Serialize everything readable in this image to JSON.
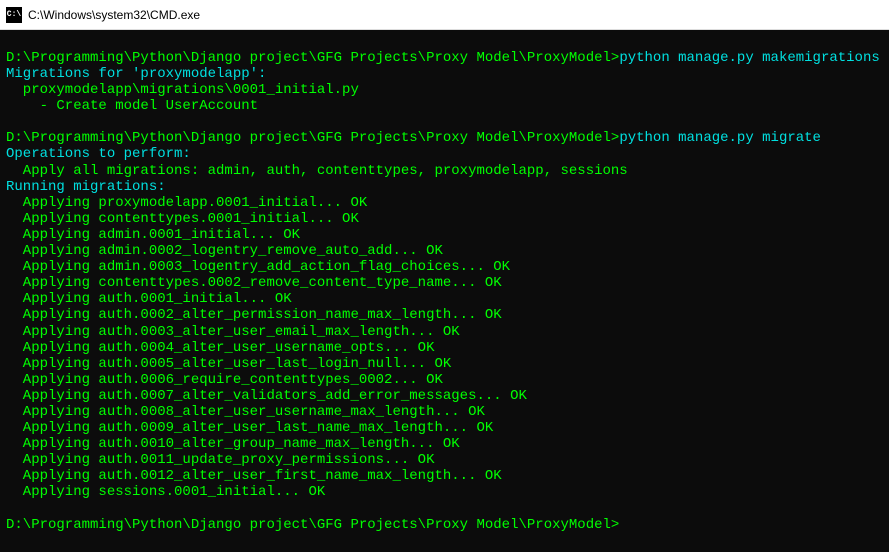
{
  "window": {
    "title": "C:\\Windows\\system32\\CMD.exe",
    "icon_label": "C:\\"
  },
  "terminal": {
    "prompt_path": "D:\\Programming\\Python\\Django project\\GFG Projects\\Proxy Model\\ProxyModel>",
    "commands": {
      "makemigrations": "python manage.py makemigrations",
      "migrate": "python manage.py migrate"
    },
    "makemigrations_output": {
      "header": "Migrations for 'proxymodelapp':",
      "file": "  proxymodelapp\\migrations\\0001_initial.py",
      "action": "    - Create model UserAccount"
    },
    "migrate_output": {
      "operations_header": "Operations to perform:",
      "apply_all": "  Apply all migrations: admin, auth, contenttypes, proxymodelapp, sessions",
      "running_header": "Running migrations:",
      "applying": [
        "  Applying proxymodelapp.0001_initial... OK",
        "  Applying contenttypes.0001_initial... OK",
        "  Applying admin.0001_initial... OK",
        "  Applying admin.0002_logentry_remove_auto_add... OK",
        "  Applying admin.0003_logentry_add_action_flag_choices... OK",
        "  Applying contenttypes.0002_remove_content_type_name... OK",
        "  Applying auth.0001_initial... OK",
        "  Applying auth.0002_alter_permission_name_max_length... OK",
        "  Applying auth.0003_alter_user_email_max_length... OK",
        "  Applying auth.0004_alter_user_username_opts... OK",
        "  Applying auth.0005_alter_user_last_login_null... OK",
        "  Applying auth.0006_require_contenttypes_0002... OK",
        "  Applying auth.0007_alter_validators_add_error_messages... OK",
        "  Applying auth.0008_alter_user_username_max_length... OK",
        "  Applying auth.0009_alter_user_last_name_max_length... OK",
        "  Applying auth.0010_alter_group_name_max_length... OK",
        "  Applying auth.0011_update_proxy_permissions... OK",
        "  Applying auth.0012_alter_user_first_name_max_length... OK",
        "  Applying sessions.0001_initial... OK"
      ]
    }
  }
}
